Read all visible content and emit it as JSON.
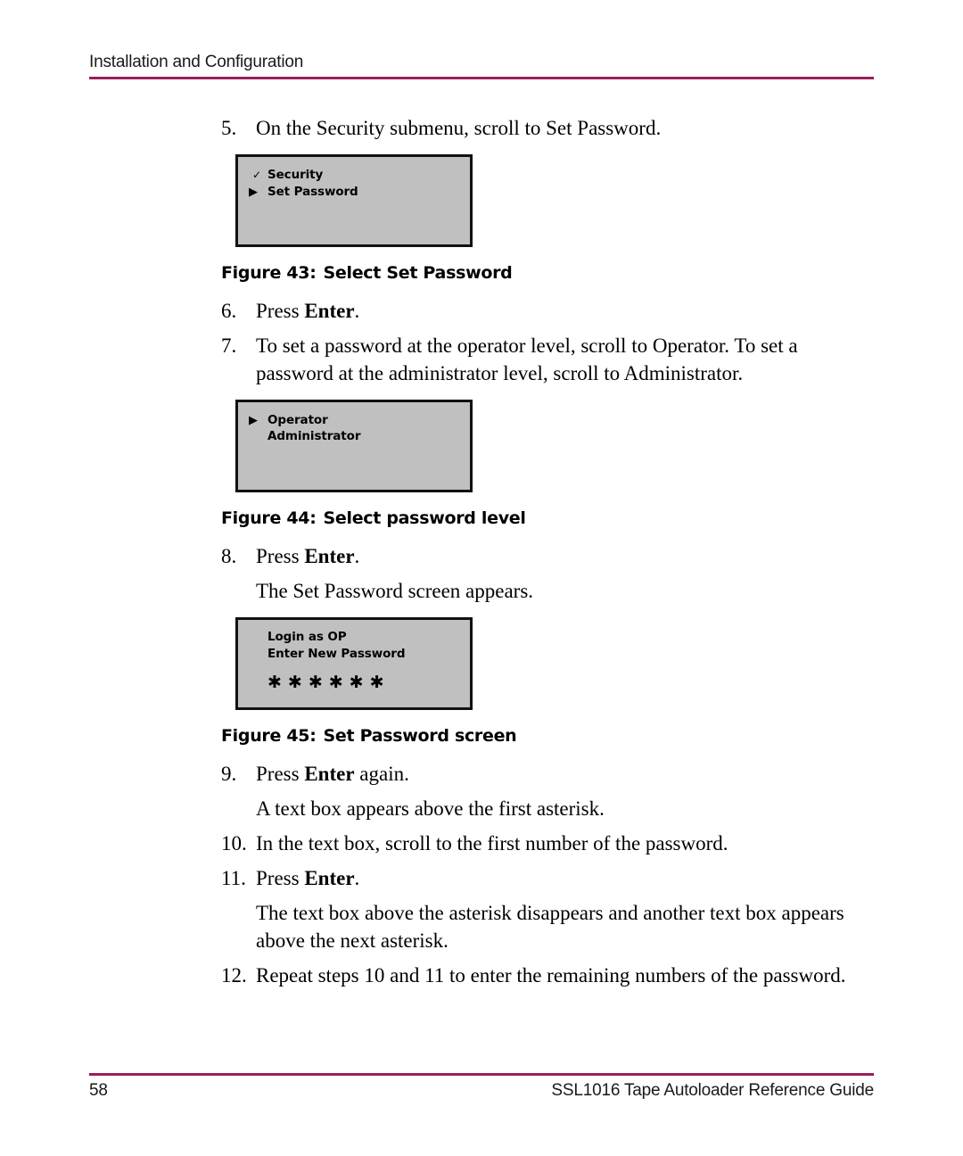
{
  "header": {
    "title": "Installation and Configuration",
    "rule_color": "#9B1E5A"
  },
  "footer": {
    "page_number": "58",
    "guide_title": "SSL1016 Tape Autoloader Reference Guide",
    "rule_color": "#9B1E5A"
  },
  "steps": {
    "s5_num": "5.",
    "s5_text": "On the Security submenu, scroll to Set Password.",
    "s6_num": "6.",
    "s6_text_pre": "Press ",
    "s6_text_bold": "Enter",
    "s6_text_post": ".",
    "s7_num": "7.",
    "s7_text": "To set a password at the operator level, scroll to Operator. To set a password at the administrator level, scroll to Administrator.",
    "s8_num": "8.",
    "s8_text_pre": "Press ",
    "s8_text_bold": "Enter",
    "s8_text_post": ".",
    "s8_sub": "The Set Password screen appears.",
    "s9_num": "9.",
    "s9_text_pre": "Press ",
    "s9_text_bold": "Enter",
    "s9_text_post": " again.",
    "s9_sub": "A text box appears above the first asterisk.",
    "s10_num": "10.",
    "s10_text": "In the text box, scroll to the first number of the password.",
    "s11_num": "11.",
    "s11_text_pre": "Press ",
    "s11_text_bold": "Enter",
    "s11_text_post": ".",
    "s11_sub": "The text box above the asterisk disappears and another text box appears above the next asterisk.",
    "s12_num": "12.",
    "s12_text": "Repeat steps 10 and 11 to enter the remaining numbers of the password."
  },
  "figures": {
    "fig43": {
      "label": "Figure 43:",
      "title": "Select Set Password",
      "screen_bg": "#c0c0c0",
      "rows": [
        {
          "marker": "✓",
          "marker_kind": "check",
          "label": "Security"
        },
        {
          "marker": "▶",
          "marker_kind": "triangle",
          "label": "Set Password"
        }
      ]
    },
    "fig44": {
      "label": "Figure 44:",
      "title": "Select password level",
      "screen_bg": "#c0c0c0",
      "rows": [
        {
          "marker": "▶",
          "marker_kind": "triangle",
          "label": "Operator"
        },
        {
          "marker": "",
          "marker_kind": "none",
          "label": "Administrator"
        }
      ]
    },
    "fig45": {
      "label": "Figure 45:",
      "title": "Set Password screen",
      "screen_bg": "#c0c0c0",
      "rows": [
        {
          "marker": "",
          "marker_kind": "none",
          "label": "Login as OP"
        },
        {
          "marker": "",
          "marker_kind": "none",
          "label": "Enter New Password"
        }
      ],
      "password_mask": "✱✱✱✱✱✱"
    }
  }
}
